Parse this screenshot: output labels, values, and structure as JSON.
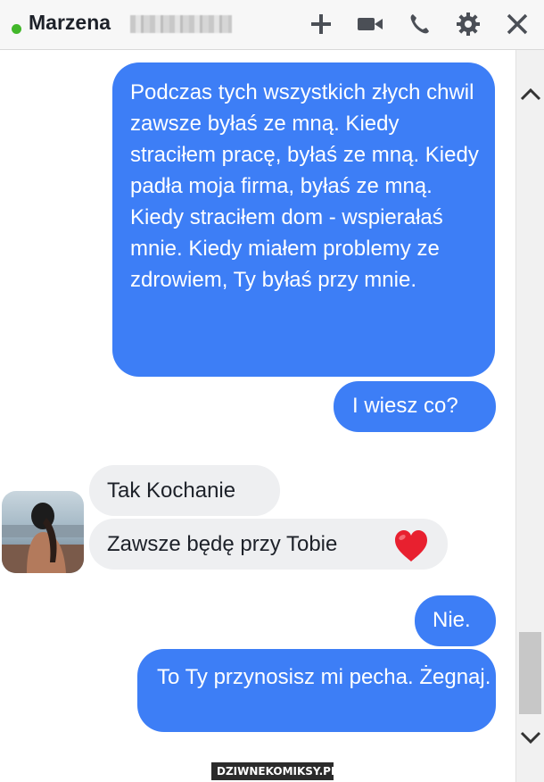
{
  "header": {
    "contact_name": "Marzena",
    "status": "online",
    "icons": [
      "plus-icon",
      "video-camera-icon",
      "phone-icon",
      "gear-icon",
      "close-icon"
    ]
  },
  "messages": [
    {
      "direction": "outgoing",
      "text": "Podczas tych wszystkich złych chwil zawsze byłaś ze mną. Kiedy straciłem pracę, byłaś ze mną. Kiedy padła moja firma, byłaś ze mną. Kiedy straciłem dom - wspierałaś mnie. Kiedy miałem problemy ze zdrowiem, Ty byłaś przy mnie."
    },
    {
      "direction": "outgoing",
      "text": "I wiesz co?"
    },
    {
      "direction": "incoming",
      "text": "Tak Kochanie"
    },
    {
      "direction": "incoming",
      "text": "Zawsze będę przy Tobie",
      "emoji": "heart-icon"
    },
    {
      "direction": "outgoing",
      "text": "Nie."
    },
    {
      "direction": "outgoing",
      "text": "To Ty przynosisz mi pecha. Żegnaj."
    }
  ],
  "colors": {
    "outgoing_bubble": "#3d7ef6",
    "incoming_bubble": "#eeeff1",
    "online": "#42b72a",
    "heart": "#e8202f"
  },
  "watermark": "DZIWNEKOMIKSY.PL"
}
